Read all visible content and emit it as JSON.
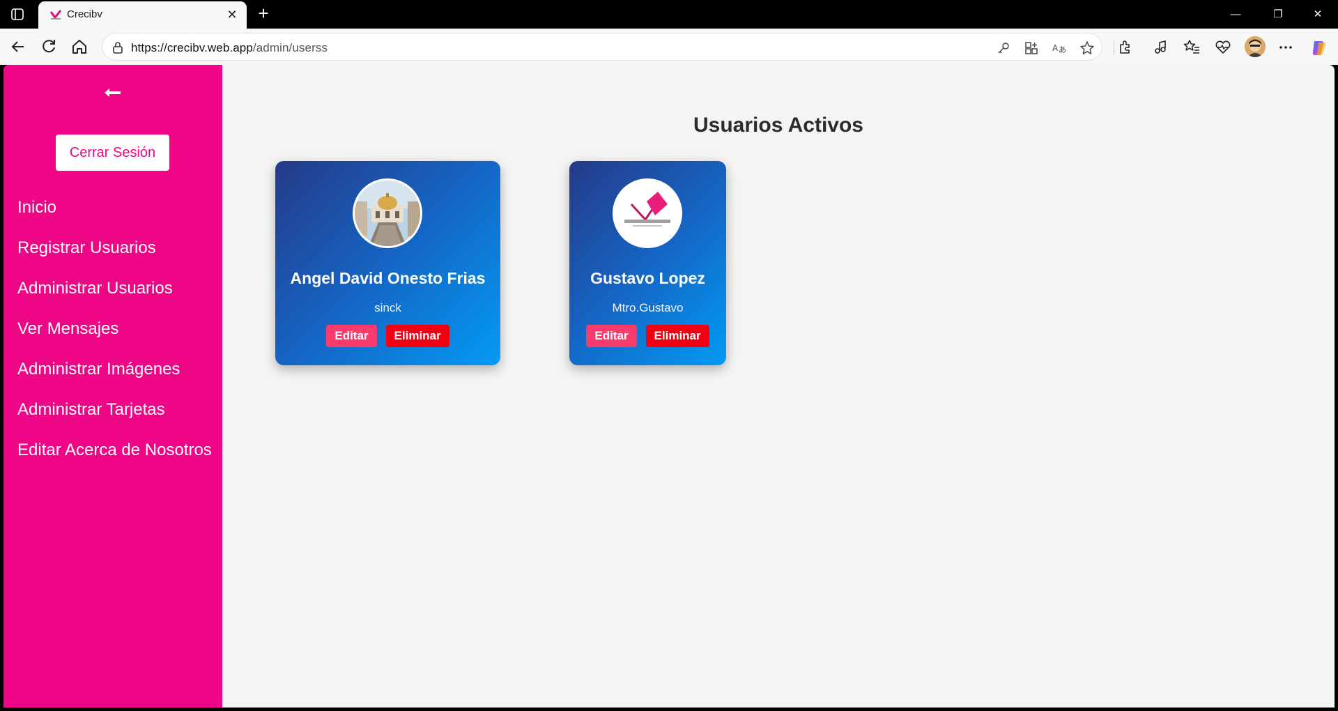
{
  "browser": {
    "tab_title": "Crecibv",
    "url_host": "https://crecibv.web.app",
    "url_path": "/admin/userss"
  },
  "sidebar": {
    "logout_label": "Cerrar Sesión",
    "items": [
      {
        "label": "Inicio"
      },
      {
        "label": "Registrar Usuarios"
      },
      {
        "label": "Administrar Usuarios"
      },
      {
        "label": "Ver Mensajes"
      },
      {
        "label": "Administrar Imágenes"
      },
      {
        "label": "Administrar Tarjetas"
      },
      {
        "label": "Editar Acerca de Nosotros"
      }
    ]
  },
  "main": {
    "title": "Usuarios Activos",
    "users": [
      {
        "name": "Angel David Onesto Frias",
        "role": "sinck",
        "edit_label": "Editar",
        "delete_label": "Eliminar"
      },
      {
        "name": "Gustavo Lopez",
        "role": "Mtro.Gustavo",
        "edit_label": "Editar",
        "delete_label": "Eliminar"
      }
    ]
  },
  "colors": {
    "sidebar_bg": "#ee0686",
    "card_gradient_start": "#253a88",
    "card_gradient_end": "#029bf3",
    "edit_button": "#fa3b6d",
    "delete_button": "#f20012"
  }
}
